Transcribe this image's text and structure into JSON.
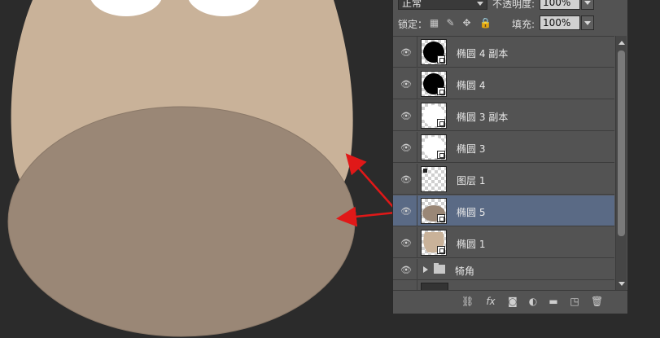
{
  "canvas": {
    "background": "#2b2b2b",
    "head_color": "#c9b299",
    "muzzle_color": "#9a8776",
    "arrow_color": "#e01818"
  },
  "layers_panel": {
    "blend_mode": "正常",
    "opacity_label": "不透明度:",
    "opacity_value": "100%",
    "lock_label": "锁定：",
    "fill_label": "填充:",
    "fill_value": "100%",
    "lock_icons": [
      "lock-transparent-icon",
      "lock-paint-icon",
      "lock-move-icon",
      "lock-all-icon"
    ],
    "layers": [
      {
        "name": "椭圆 4 副本",
        "thumb": "black-circle",
        "visible": true,
        "selected": false
      },
      {
        "name": "椭圆 4",
        "thumb": "black-circle",
        "visible": true,
        "selected": false
      },
      {
        "name": "椭圆 3 副本",
        "thumb": "white-circle",
        "visible": true,
        "selected": false
      },
      {
        "name": "椭圆 3",
        "thumb": "white-circle",
        "visible": true,
        "selected": false
      },
      {
        "name": "图层 1",
        "thumb": "transparent",
        "visible": true,
        "selected": false
      },
      {
        "name": "椭圆 5",
        "thumb": "muzzle-ellipse",
        "visible": true,
        "selected": true
      },
      {
        "name": "椭圆 1",
        "thumb": "head-shape",
        "visible": true,
        "selected": false
      },
      {
        "name": "犄角",
        "thumb": "folder",
        "visible": true,
        "selected": false
      }
    ],
    "footer_icons": [
      "link-icon",
      "fx-icon",
      "mask-icon",
      "adjustment-icon",
      "folder-icon",
      "new-layer-icon",
      "trash-icon"
    ],
    "footer_fx_label": "fx"
  }
}
